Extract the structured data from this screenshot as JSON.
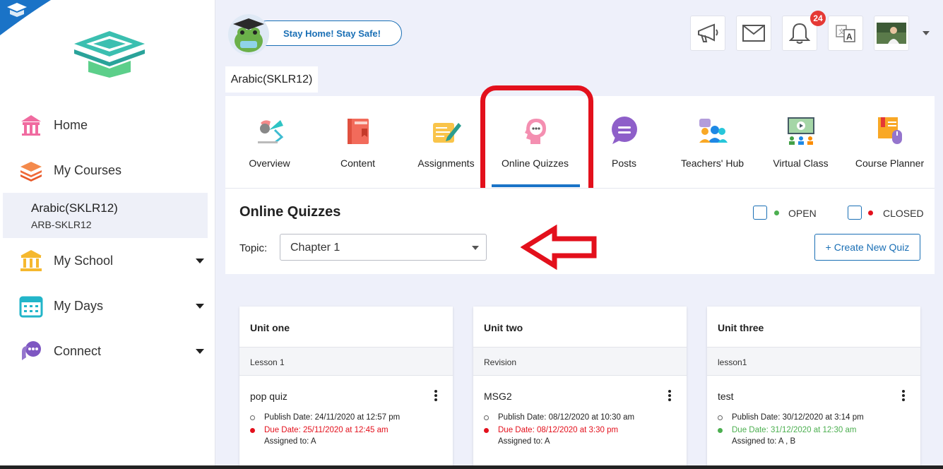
{
  "sidebar": {
    "nav": [
      {
        "label": "Home",
        "icon": "home-icon"
      },
      {
        "label": "My Courses",
        "icon": "courses-icon"
      },
      {
        "label": "My School",
        "icon": "school-icon"
      },
      {
        "label": "My Days",
        "icon": "calendar-icon"
      },
      {
        "label": "Connect",
        "icon": "connect-icon"
      }
    ],
    "active_course": {
      "name": "Arabic(SKLR12)",
      "code": "ARB-SKLR12"
    }
  },
  "topbar": {
    "stay_message": "Stay Home! Stay Safe!",
    "notification_count": "24",
    "buttons": [
      "megaphone-icon",
      "mail-icon",
      "bell-icon",
      "translate-icon",
      "profile-avatar"
    ]
  },
  "course_tab": "Arabic(SKLR12)",
  "tools": [
    {
      "label": "Overview"
    },
    {
      "label": "Content"
    },
    {
      "label": "Assignments"
    },
    {
      "label": "Online Quizzes",
      "active": true
    },
    {
      "label": "Posts"
    },
    {
      "label": "Teachers' Hub"
    },
    {
      "label": "Virtual Class"
    },
    {
      "label": "Course Planner"
    }
  ],
  "panel": {
    "title": "Online Quizzes",
    "legend_open": "OPEN",
    "legend_closed": "CLOSED",
    "topic_label": "Topic:",
    "topic_value": "Chapter 1",
    "create_button": "+ Create New Quiz"
  },
  "cards": [
    {
      "unit": "Unit one",
      "lesson": "Lesson 1",
      "quiz": "pop quiz",
      "publish": "Publish Date: 24/11/2020 at 12:57 pm",
      "due": "Due Date: 25/11/2020 at 12:45 am",
      "assigned": "Assigned to: A",
      "status": "closed"
    },
    {
      "unit": "Unit two",
      "lesson": "Revision",
      "quiz": "MSG2",
      "publish": "Publish Date: 08/12/2020 at 10:30 am",
      "due": "Due Date: 08/12/2020 at 3:30 pm",
      "assigned": "Assigned to: A",
      "status": "closed"
    },
    {
      "unit": "Unit three",
      "lesson": "lesson1",
      "quiz": "test",
      "publish": "Publish Date: 30/12/2020 at 3:14 pm",
      "due": "Due Date: 31/12/2020 at 12:30 am",
      "assigned": "Assigned to: A , B",
      "status": "open"
    }
  ],
  "colors": {
    "accent": "#1a73c7",
    "open": "#4caf50",
    "closed": "#e3101c",
    "highlight": "#e3101c"
  }
}
